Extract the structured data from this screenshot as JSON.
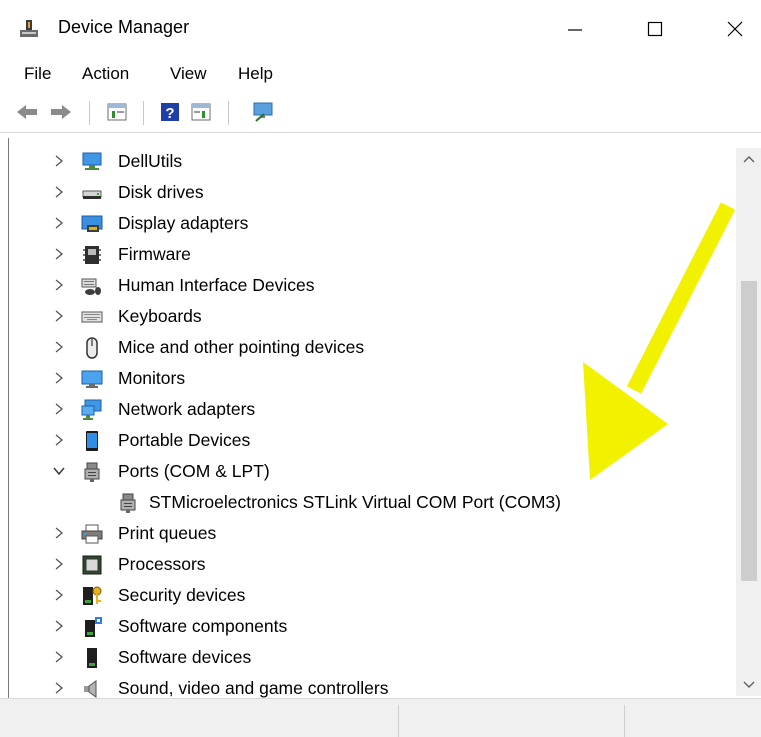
{
  "window": {
    "title": "Device Manager"
  },
  "menu": [
    "File",
    "Action",
    "View",
    "Help"
  ],
  "toolbar": {
    "buttons": [
      "back-icon",
      "forward-icon",
      "properties-icon",
      "help-icon",
      "show-hide-icon",
      "scan-hardware-icon"
    ]
  },
  "tree": {
    "items": [
      {
        "label": "DellUtils",
        "icon": "monitor-network-icon",
        "expanded": false
      },
      {
        "label": "Disk drives",
        "icon": "disk-drive-icon",
        "expanded": false
      },
      {
        "label": "Display adapters",
        "icon": "display-adapter-icon",
        "expanded": false
      },
      {
        "label": "Firmware",
        "icon": "firmware-icon",
        "expanded": false
      },
      {
        "label": "Human Interface Devices",
        "icon": "hid-icon",
        "expanded": false
      },
      {
        "label": "Keyboards",
        "icon": "keyboard-icon",
        "expanded": false
      },
      {
        "label": "Mice and other pointing devices",
        "icon": "mouse-icon",
        "expanded": false
      },
      {
        "label": "Monitors",
        "icon": "monitor-icon",
        "expanded": false
      },
      {
        "label": "Network adapters",
        "icon": "network-adapter-icon",
        "expanded": false
      },
      {
        "label": "Portable Devices",
        "icon": "portable-device-icon",
        "expanded": false
      },
      {
        "label": "Ports (COM & LPT)",
        "icon": "port-icon",
        "expanded": true
      },
      {
        "label": "STMicroelectronics STLink Virtual COM Port (COM3)",
        "icon": "port-icon",
        "child": true
      },
      {
        "label": "Print queues",
        "icon": "printer-icon",
        "expanded": false
      },
      {
        "label": "Processors",
        "icon": "processor-icon",
        "expanded": false
      },
      {
        "label": "Security devices",
        "icon": "security-icon",
        "expanded": false
      },
      {
        "label": "Software components",
        "icon": "software-component-icon",
        "expanded": false
      },
      {
        "label": "Software devices",
        "icon": "software-device-icon",
        "expanded": false
      },
      {
        "label": "Sound, video and game controllers",
        "icon": "speaker-icon",
        "expanded": false
      }
    ]
  },
  "colors": {
    "annotation_arrow": "#f2f200",
    "accent": "#1c7cd6"
  }
}
